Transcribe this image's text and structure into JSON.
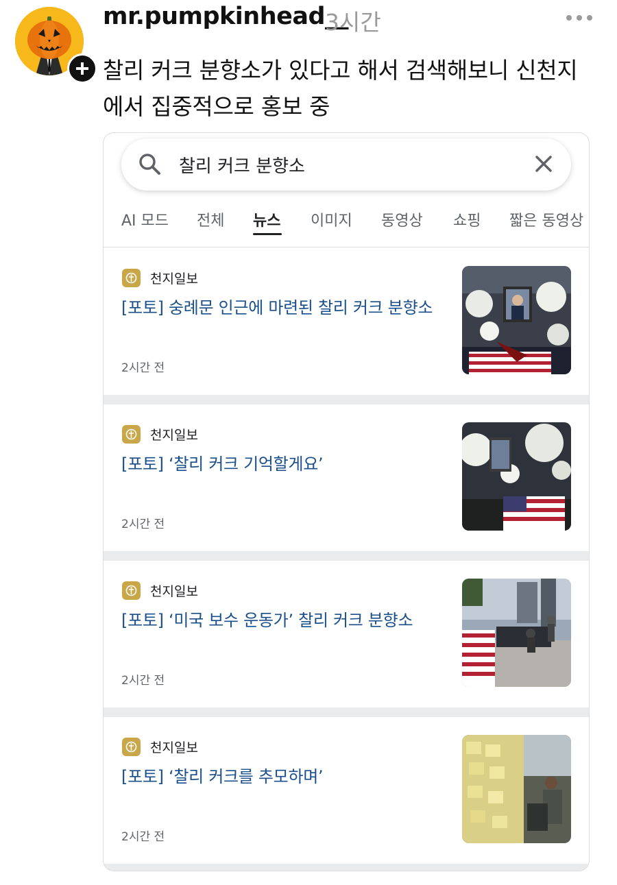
{
  "post": {
    "username": "mr.pumpkinhead__",
    "timestamp": "3시간",
    "text": "찰리 커크 분향소가 있다고 해서 검색해보니 신천지에서 집중적으로 홍보 중"
  },
  "search": {
    "query": "찰리 커크 분향소",
    "tabs": [
      "AI 모드",
      "전체",
      "뉴스",
      "이미지",
      "동영상",
      "쇼핑",
      "짧은 동영상"
    ],
    "active_tab": "뉴스"
  },
  "results": [
    {
      "source": "천지일보",
      "headline": "[포토] 숭례문 인근에 마련된 찰리 커크 분향소",
      "time": "2시간 전"
    },
    {
      "source": "천지일보",
      "headline": "[포토] ‘찰리 커크 기억할게요’",
      "time": "2시간 전"
    },
    {
      "source": "천지일보",
      "headline": "[포토] ‘미국 보수 운동가’ 찰리 커크 분향소",
      "time": "2시간 전"
    },
    {
      "source": "천지일보",
      "headline": "[포토] ‘찰리 커크를 추모하며’",
      "time": "2시간 전"
    }
  ],
  "colors": {
    "headline": "#1a4f8b",
    "avatar_bg": "#f6b81a",
    "source_logo": "#c9a648"
  }
}
